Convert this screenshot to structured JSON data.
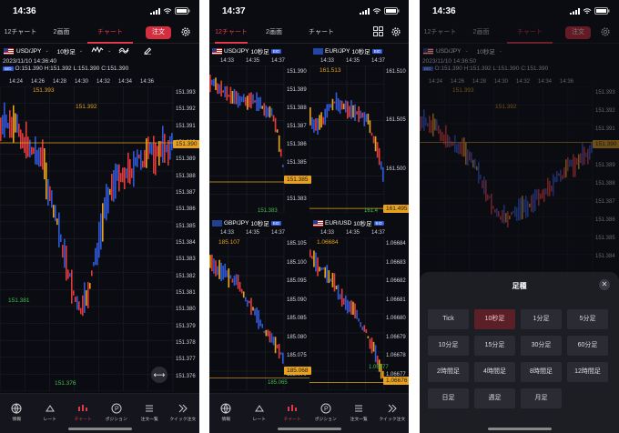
{
  "phone1": {
    "time": "14:36",
    "tabs": [
      "12チャート",
      "2画面",
      "チャート"
    ],
    "order": "注文",
    "pair": "USD/JPY",
    "interval": "10秒足",
    "datetime": "2023/11/10 14:36:40",
    "bid": "BID",
    "ohlc": "O:151.390  H:151.392  L:151.390  C:151.390",
    "times": [
      "14:24",
      "14:26",
      "14:28",
      "14:30",
      "14:32",
      "14:34",
      "14:36"
    ],
    "yticks": [
      "151.393",
      "151.392",
      "151.391",
      "151.390",
      "151.389",
      "151.388",
      "151.387",
      "151.386",
      "151.385",
      "151.384",
      "151.383",
      "151.382",
      "151.381",
      "151.380",
      "151.379",
      "151.378",
      "151.377",
      "151.376"
    ],
    "high_label": "151.393",
    "high2_label": "151.392",
    "low_label": "151.381",
    "low2_label": "151.376",
    "current": "151.390"
  },
  "phone2": {
    "time": "14:37",
    "tabs": [
      "12チャート",
      "2画面",
      "チャート"
    ],
    "charts": [
      {
        "pair": "USD/JPY",
        "interval": "10秒足",
        "bid": "BID",
        "times": [
          "14:33",
          "14:35",
          "14:37"
        ],
        "yticks": [
          "151.390",
          "151.389",
          "151.388",
          "151.387",
          "151.386",
          "151.385",
          "151.384",
          "151.383"
        ],
        "current": "151.385",
        "low": "151.383"
      },
      {
        "pair": "EUR/JPY",
        "interval": "10秒足",
        "bid": "BID",
        "times": [
          "14:33",
          "14:35",
          "14:37"
        ],
        "yticks": [
          "161.510",
          "161.505",
          "161.500"
        ],
        "current": "161.495",
        "high": "161.513",
        "low": "161.4"
      },
      {
        "pair": "GBP/JPY",
        "interval": "10秒足",
        "bid": "BID",
        "times": [
          "14:33",
          "14:35",
          "14:37"
        ],
        "yticks": [
          "185.105",
          "185.100",
          "185.095",
          "185.090",
          "185.085",
          "185.080",
          "185.075",
          "185.070"
        ],
        "current": "185.068",
        "high": "185.107",
        "low": "185.065"
      },
      {
        "pair": "EUR/USD",
        "interval": "10秒足",
        "bid": "BID",
        "times": [
          "14:33",
          "14:35",
          "14:37"
        ],
        "yticks": [
          "1.06684",
          "1.06683",
          "1.06682",
          "1.06681",
          "1.06680",
          "1.06679",
          "1.06678",
          "1.06677"
        ],
        "current": "1.06676",
        "high": "1.06684",
        "low": "1.06677"
      }
    ]
  },
  "phone3": {
    "time": "14:36",
    "tabs": [
      "12チャート",
      "2画面",
      "チャート"
    ],
    "order": "注文",
    "pair": "USD/JPY",
    "interval": "10秒足",
    "datetime": "2023/11/10 14:36:50",
    "bid": "BID",
    "ohlc": "O:151.390  H:151.392  L:151.390  C:151.390",
    "times": [
      "14:24",
      "14:26",
      "14:28",
      "14:30",
      "14:32",
      "14:34",
      "14:36"
    ],
    "yticks": [
      "151.393",
      "151.392",
      "151.391",
      "151.390",
      "151.389",
      "151.388",
      "151.387",
      "151.386",
      "151.385",
      "151.384"
    ],
    "high_label": "151.393",
    "high2_label": "151.392",
    "current": "151.390",
    "sheet_title": "足種",
    "options": [
      "Tick",
      "10秒足",
      "1分足",
      "5分足",
      "10分足",
      "15分足",
      "30分足",
      "60分足",
      "2時間足",
      "4時間足",
      "8時間足",
      "12時間足",
      "日足",
      "週足",
      "月足"
    ],
    "selected": "10秒足"
  },
  "nav": [
    "情報",
    "レート",
    "チャート",
    "ポジション",
    "注文一覧",
    "クイック注文"
  ],
  "colors": {
    "accent": "#e13a4b",
    "up": "#e03a3a",
    "down": "#2f58d6",
    "neutral": "#e6a31d"
  }
}
